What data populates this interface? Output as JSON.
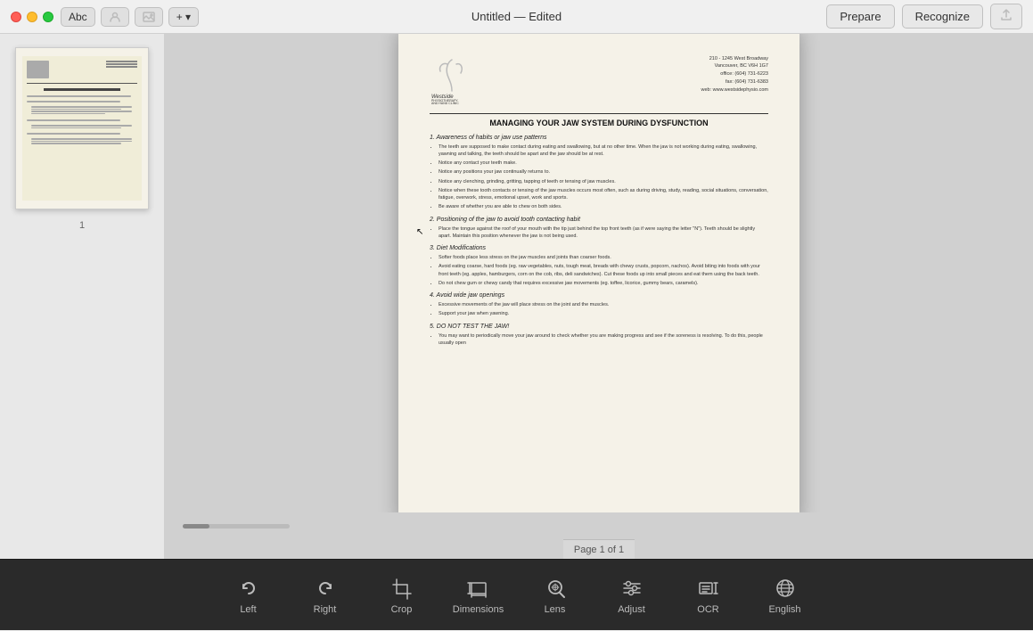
{
  "window": {
    "title": "Untitled — Edited",
    "traffic_lights": [
      "close",
      "minimize",
      "maximize"
    ]
  },
  "toolbar_top": {
    "tools": [
      {
        "id": "text-tool",
        "label": "Abc"
      },
      {
        "id": "contact-tool",
        "label": "👤"
      },
      {
        "id": "image-tool",
        "label": "🖼"
      },
      {
        "id": "add-tool",
        "label": "+"
      }
    ],
    "actions": [
      {
        "id": "prepare-btn",
        "label": "Prepare"
      },
      {
        "id": "recognize-btn",
        "label": "Recognize"
      }
    ],
    "share_label": "↑"
  },
  "sidebar": {
    "pages": [
      {
        "number": "1",
        "selected": true
      }
    ]
  },
  "document": {
    "logo_text": "Westside\nPHYSIOTHERAPY\nAND HAND CLINIC",
    "contact": "210 - 1245 West Broadway\nVancouver, BC V6H 1G7\noffice: (604) 731-6223\nfax: (604) 731-6383\nweb: www.westsidephysio.com",
    "title": "MANAGING YOUR JAW SYSTEM DURING DYSFUNCTION",
    "sections": [
      {
        "num": "1.",
        "title": "Awareness of habits or jaw use patterns",
        "bullets": [
          "The teeth are supposed to make contact during eating and swallowing, but at no other time. When the jaw is not working during eating, swallowing, yawning and talking, the teeth should be apart and the jaw should be at rest.",
          "Notice any contact your teeth make.",
          "Notice any positions your jaw continually returns to.",
          "Notice any clenching, grinding, gritting, tapping of teeth or tensing of jaw muscles.",
          "Notice when these tooth contacts or tensing of the jaw muscles occurs most often, such as during driving, study, reading, social situations, conversation, fatigue, overwork, stress, emotional upset, work and sports.",
          "Be aware of whether you are able to chew on both sides."
        ]
      },
      {
        "num": "2.",
        "title": "Positioning of the jaw to avoid tooth contacting habit",
        "bullets": [
          "Place the tongue against the roof of your mouth with the tip just behind the top front teeth (as if were saying the letter \"N\"). Teeth should be slightly apart. Maintain this position whenever the jaw is not being used."
        ]
      },
      {
        "num": "3.",
        "title": "Diet Modifications",
        "bullets": [
          "Softer foods place less stress on the jaw muscles and joints than coarser foods.",
          "Avoid eating coarse, hard foods (eg. raw vegetables, nuts, tough meat, breads with chewy crusts, popcorn, nachos). Avoid biting into foods with your front teeth (eg. apples, hamburgers, corn on the cob, ribs, deli sandwiches). Cut these foods up into small pieces and eat them using the back teeth.",
          "Do not chew gum or chewy candy that requires excessive jaw movements (eg. toffee, licorice, gummy bears, caramels)."
        ]
      },
      {
        "num": "4.",
        "title": "Avoid wide jaw openings",
        "bullets": [
          "Excessive movements of the jaw will place stress on the joint and the muscles.",
          "Support your jaw when yawning."
        ]
      },
      {
        "num": "5.",
        "title": "DO NOT TEST THE JAW!",
        "bullets": [
          "You may want to periodically move your jaw around to check whether you are making progress and see if the soreness is resolving. To do this, people usually open"
        ]
      }
    ]
  },
  "status": {
    "page_info": "Page 1 of 1"
  },
  "bottom_toolbar": {
    "items": [
      {
        "id": "left",
        "label": "Left",
        "icon": "rotate-left"
      },
      {
        "id": "right",
        "label": "Right",
        "icon": "rotate-right"
      },
      {
        "id": "crop",
        "label": "Crop",
        "icon": "crop"
      },
      {
        "id": "dimensions",
        "label": "Dimensions",
        "icon": "dimensions"
      },
      {
        "id": "lens",
        "label": "Lens",
        "icon": "lens"
      },
      {
        "id": "adjust",
        "label": "Adjust",
        "icon": "adjust"
      },
      {
        "id": "ocr",
        "label": "OCR",
        "icon": "ocr"
      },
      {
        "id": "english",
        "label": "English",
        "icon": "globe"
      }
    ]
  }
}
